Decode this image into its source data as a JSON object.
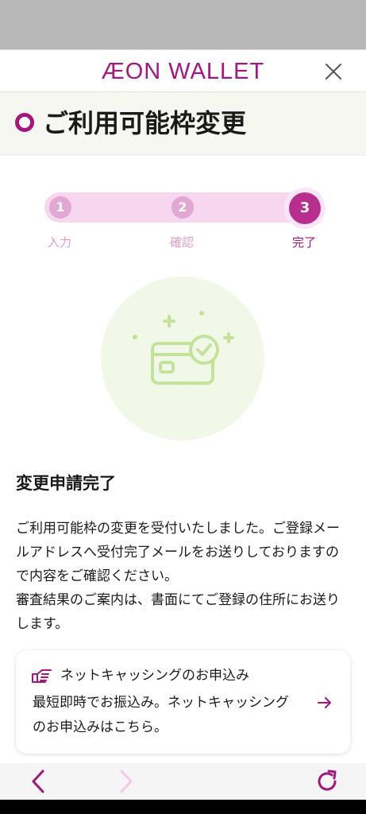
{
  "header": {
    "brand": "ÆON WALLET",
    "close_icon": "close-icon"
  },
  "page": {
    "title": "ご利用可能枠変更"
  },
  "stepper": {
    "current_step": 3,
    "steps": [
      {
        "number": "1",
        "label": "入力"
      },
      {
        "number": "2",
        "label": "確認"
      },
      {
        "number": "3",
        "label": "完了"
      }
    ]
  },
  "result": {
    "heading": "変更申請完了",
    "message": [
      "ご利用可能枠の変更を受付いたしました。ご登録メールアドレスへ受付完了メールをお送りしておりますので内容をご確認ください。",
      "審査結果のご案内は、書面にてご登録の住所にお送りします。"
    ]
  },
  "cta": {
    "title": "ネットキャッシングのお申込み",
    "body": "最短即時でお振込み。ネットキャッシングのお申込みはこちら。"
  },
  "colors": {
    "brand": "#a6157e",
    "step_inactive": "#e2a7d2",
    "track": "#f7d6ef",
    "success": "#c4e39a"
  },
  "icons": [
    "close-icon",
    "ring-icon",
    "credit-card-check-icon",
    "pointing-hand-icon",
    "arrow-right-icon",
    "back-icon",
    "forward-icon",
    "reload-icon"
  ]
}
